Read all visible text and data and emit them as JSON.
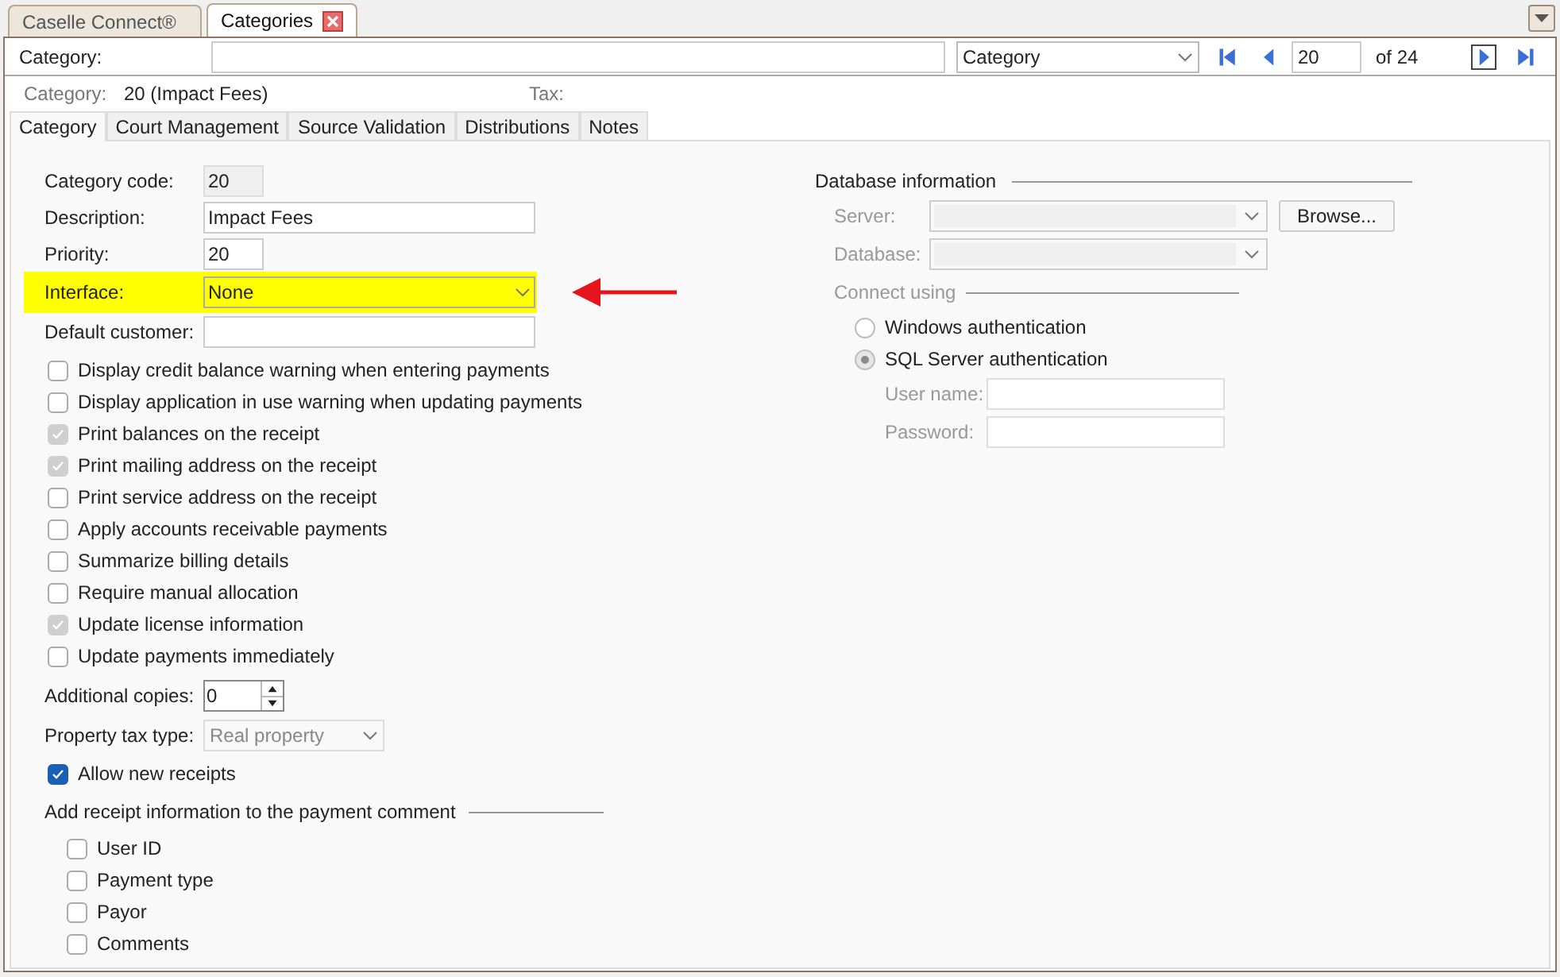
{
  "doc_tabs": [
    {
      "label": "Caselle Connect®",
      "selected": false,
      "closable": false
    },
    {
      "label": "Categories",
      "selected": true,
      "closable": true
    }
  ],
  "search": {
    "label": "Category:",
    "field": "Category",
    "record": "20",
    "of": "of 24"
  },
  "info": {
    "label": "Category:",
    "value": "20 (Impact Fees)",
    "tax_label": "Tax:"
  },
  "tabs": [
    {
      "label": "Category",
      "selected": true
    },
    {
      "label": "Court Management",
      "selected": false
    },
    {
      "label": "Source Validation",
      "selected": false
    },
    {
      "label": "Distributions",
      "selected": false
    },
    {
      "label": "Notes",
      "selected": false
    }
  ],
  "fields": [
    {
      "kind": "readonly",
      "label": "Category code:",
      "value": "20",
      "highlighted": false
    },
    {
      "kind": "text",
      "label": "Description:",
      "value": "Impact Fees",
      "highlighted": false
    },
    {
      "kind": "short",
      "label": "Priority:",
      "value": "20",
      "highlighted": false
    },
    {
      "kind": "select",
      "label": "Interface:",
      "value": "None",
      "highlighted": true
    },
    {
      "kind": "text",
      "label": "Default customer:",
      "highlighted": false
    }
  ],
  "options": [
    {
      "label": "Display credit balance warning when entering payments",
      "checked": false,
      "disabled": false
    },
    {
      "label": "Display application in use warning when updating payments",
      "checked": false,
      "disabled": false
    },
    {
      "label": "Print balances on the receipt",
      "checked": true,
      "disabled": true
    },
    {
      "label": "Print mailing address on the receipt",
      "checked": true,
      "disabled": true
    },
    {
      "label": "Print service address on the receipt",
      "checked": false,
      "disabled": false
    },
    {
      "label": "Apply accounts receivable payments",
      "checked": false,
      "disabled": false
    },
    {
      "label": "Summarize billing details",
      "checked": false,
      "disabled": false
    },
    {
      "label": "Require manual allocation",
      "checked": false,
      "disabled": false
    },
    {
      "label": "Update license information",
      "checked": true,
      "disabled": true
    },
    {
      "label": "Update payments immediately",
      "checked": false,
      "disabled": false
    }
  ],
  "additional_copies": {
    "label": "Additional copies:",
    "value": "0"
  },
  "property_tax_type": {
    "label": "Property tax type:",
    "value": "Real property"
  },
  "allow_new_receipts": {
    "label": "Allow new receipts",
    "checked": true,
    "disabled": false
  },
  "receipt_info": {
    "title": "Add receipt information to the payment comment",
    "items": [
      {
        "label": "User ID",
        "checked": false,
        "disabled": false
      },
      {
        "label": "Payment type",
        "checked": false,
        "disabled": false
      },
      {
        "label": "Payor",
        "checked": false,
        "disabled": false
      },
      {
        "label": "Comments",
        "checked": false,
        "disabled": false
      }
    ]
  },
  "database": {
    "title": "Database information",
    "server_label": "Server:",
    "database_label": "Database:",
    "browse": "Browse...",
    "connect_title": "Connect using",
    "auth": [
      {
        "label": "Windows authentication",
        "selected": false
      },
      {
        "label": "SQL Server authentication",
        "selected": true
      }
    ],
    "user_label": "User name:",
    "password_label": "Password:"
  }
}
